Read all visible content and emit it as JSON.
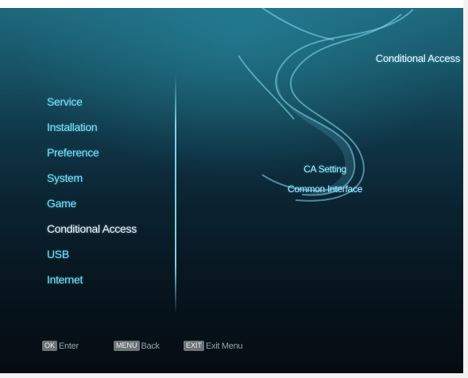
{
  "header": {
    "title": "Conditional Access"
  },
  "main_menu": {
    "items": [
      {
        "label": "Service"
      },
      {
        "label": "Installation"
      },
      {
        "label": "Preference"
      },
      {
        "label": "System"
      },
      {
        "label": "Game"
      },
      {
        "label": "Conditional Access"
      },
      {
        "label": "USB"
      },
      {
        "label": "Internet"
      }
    ],
    "selected": "Conditional Access"
  },
  "sub_menu": {
    "items": [
      {
        "label": "CA Setting"
      },
      {
        "label": "Common Interface"
      }
    ]
  },
  "footer": {
    "hints": [
      {
        "key": "OK",
        "label": "Enter"
      },
      {
        "key": "MENU",
        "label": "Back"
      },
      {
        "key": "EXIT",
        "label": "Exit Menu"
      }
    ]
  },
  "colors": {
    "menu_text": "#7fe0f7",
    "menu_selected_text": "#f2f8fb",
    "background_top": "#1f6a80",
    "background_bottom": "#050c12",
    "key_badge": "#6d7478"
  },
  "icons": {
    "logo": "stylized-s-swirl-icon"
  }
}
